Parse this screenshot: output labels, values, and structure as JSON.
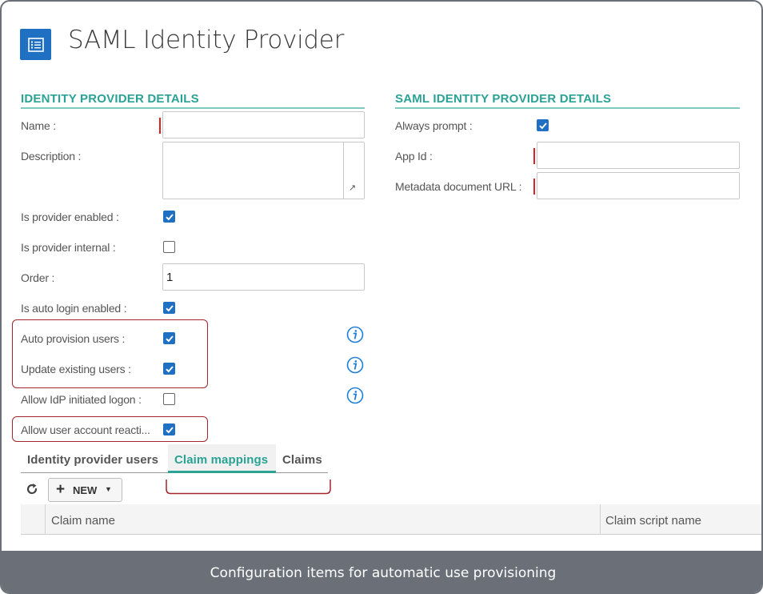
{
  "page": {
    "title": "SAML Identity Provider",
    "icon": "list-form-icon",
    "accent": "#2aa294",
    "brand": "#1f6fc2",
    "highlight_color": "#a3252e"
  },
  "identity_provider_details": {
    "title": "IDENTITY PROVIDER DETAILS",
    "name_label": "Name :",
    "name_value": "",
    "description_label": "Description :",
    "description_value": "",
    "is_provider_enabled_label": "Is provider enabled :",
    "is_provider_enabled": true,
    "is_provider_internal_label": "Is provider internal :",
    "is_provider_internal": false,
    "order_label": "Order :",
    "order_value": "1",
    "is_auto_login_enabled_label": "Is auto login enabled :",
    "is_auto_login_enabled": true,
    "auto_provision_users_label": "Auto provision users :",
    "auto_provision_users": true,
    "update_existing_users_label": "Update existing users :",
    "update_existing_users": true,
    "allow_idp_initiated_logon_label": "Allow IdP initiated logon :",
    "allow_idp_initiated_logon": false,
    "allow_user_account_reactivation_label": "Allow user account reacti...",
    "allow_user_account_reactivation": true
  },
  "saml_identity_provider_details": {
    "title": "SAML IDENTITY PROVIDER DETAILS",
    "always_prompt_label": "Always prompt :",
    "always_prompt": true,
    "app_id_label": "App Id :",
    "app_id_value": "",
    "metadata_document_url_label": "Metadata document URL :",
    "metadata_document_url_value": ""
  },
  "tabs": {
    "items": [
      {
        "label": "Identity provider users",
        "active": false
      },
      {
        "label": "Claim mappings",
        "active": true
      },
      {
        "label": "Claims",
        "active": false
      }
    ]
  },
  "toolbar": {
    "refresh_icon": "refresh-icon",
    "new_label": "NEW"
  },
  "grid": {
    "columns": [
      "Claim name",
      "Claim script name"
    ]
  },
  "caption": "Configuration items for automatic use provisioning"
}
